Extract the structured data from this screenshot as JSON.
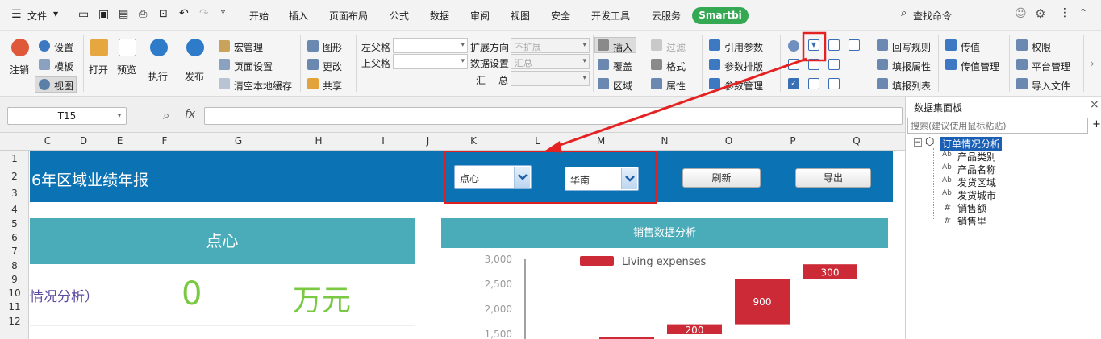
{
  "menu": {
    "file_label": "文件",
    "tabs": [
      "开始",
      "插入",
      "页面布局",
      "公式",
      "数据",
      "审阅",
      "视图",
      "安全",
      "开发工具",
      "云服务"
    ],
    "smartbi_label": "Smartbi",
    "search_label": "查找命令"
  },
  "ribbon": {
    "logout": "注销",
    "settings": "设置",
    "template": "模板",
    "view": "视图",
    "open": "打开",
    "preview": "预览",
    "execute": "执行",
    "publish": "发布",
    "macro_manage": "宏管理",
    "page_setup": "页面设置",
    "clear_cache": "清空本地缓存",
    "chart": "图形",
    "change": "更改",
    "share": "共享",
    "left_parent": "左父格",
    "top_parent": "上父格",
    "expand_dir": "扩展方向",
    "expand_value": "不扩展",
    "data_setting": "数据设置",
    "data_value": "汇总",
    "summary_1": "汇",
    "summary_2": "总",
    "insert": "插入",
    "cover": "覆盖",
    "region": "区域",
    "filter": "过滤",
    "format": "格式",
    "property": "属性",
    "ref_param": "引用参数",
    "param_layout": "参数排版",
    "param_manage": "参数管理",
    "writeback_rule": "回写规则",
    "fill_property": "填报属性",
    "fill_list": "填报列表",
    "pass_value": "传值",
    "pass_value_manage": "传值管理",
    "permission": "权限",
    "platform_manage": "平台管理",
    "import_file": "导入文件"
  },
  "formula_bar": {
    "cell_ref": "T15",
    "fx": "fx",
    "content": ""
  },
  "columns": [
    "C",
    "D",
    "E",
    "F",
    "G",
    "H",
    "I",
    "J",
    "K",
    "L",
    "M",
    "N",
    "O",
    "P",
    "Q"
  ],
  "rows": [
    "1",
    "2",
    "3",
    "4",
    "5",
    "6",
    "7",
    "8",
    "9",
    "10",
    "11",
    "12"
  ],
  "sheet": {
    "banner_title": "6年区域业绩年报",
    "dropdown_category": "点心",
    "dropdown_region": "华南",
    "refresh": "刷新",
    "export": "导出",
    "card_title": "点心",
    "card_label": "情况分析）",
    "card_value": "0",
    "card_unit": "万元",
    "chart_header": "销售数据分析"
  },
  "chart_data": {
    "type": "bar",
    "title": "",
    "legend": [
      "Living expenses"
    ],
    "legend_placement": "top",
    "y_ticks": [
      "3,000",
      "2,500",
      "2,000",
      "1,500"
    ],
    "ylim": [
      1500,
      3000
    ],
    "series": [
      {
        "name": "Living expenses",
        "bars": [
          {
            "base": 1300,
            "top": 1450,
            "label": ""
          },
          {
            "base": 1500,
            "top": 1700,
            "label": "200"
          },
          {
            "base": 1700,
            "top": 2600,
            "label": "900"
          },
          {
            "base": 2600,
            "top": 2900,
            "label": "300"
          }
        ]
      }
    ],
    "colors": {
      "bar": "#cc2a36"
    }
  },
  "panel": {
    "title": "数据集面板",
    "search_placeholder": "搜索(建议使用鼠标粘贴)",
    "root": "订单情况分析",
    "fields": [
      {
        "kind": "Ab",
        "name": "产品类别"
      },
      {
        "kind": "Ab",
        "name": "产品名称"
      },
      {
        "kind": "Ab",
        "name": "发货区域"
      },
      {
        "kind": "Ab",
        "name": "发货城市"
      },
      {
        "kind": "#",
        "name": "销售额"
      },
      {
        "kind": "#",
        "name": "销售里"
      }
    ]
  }
}
